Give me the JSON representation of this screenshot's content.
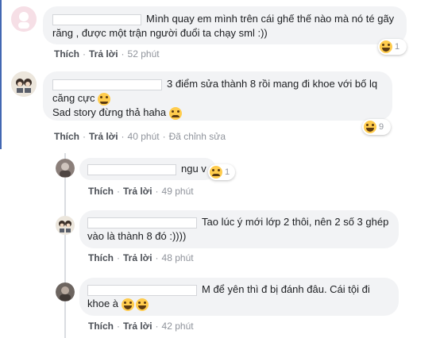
{
  "comments": [
    {
      "text": "Mình quay em mình trên cái ghế thế nào mà nó té gãy răng , được một trận người đuổi ta chạy sml :))",
      "actions": {
        "like": "Thích",
        "reply": "Trả lời",
        "time": "52 phút"
      },
      "reaction_count": "1"
    },
    {
      "text_line1": "3 điểm sửa thành 8 rồi mang đi khoe với bố lq căng cực",
      "text_line2": "Sad story đừng thả haha",
      "actions": {
        "like": "Thích",
        "reply": "Trả lời",
        "time": "40 phút",
        "edited": "Đã chỉnh sửa"
      },
      "reaction_count": "9"
    }
  ],
  "replies": [
    {
      "text": "ngu v",
      "actions": {
        "like": "Thích",
        "reply": "Trả lời",
        "time": "49 phút"
      },
      "reaction_count": "1"
    },
    {
      "text": "Tao lúc ý mới lớp 2 thôi, nên 2 số 3 ghép vào là thành 8 đó :))))",
      "actions": {
        "like": "Thích",
        "reply": "Trả lời",
        "time": "48 phút"
      }
    },
    {
      "text": "M để yên thì đ bị đánh đâu. Cái tội đi khoe à",
      "actions": {
        "like": "Thích",
        "reply": "Trả lời",
        "time": "42 phút"
      }
    }
  ],
  "icons": {
    "reaction": "haha-emoji-icon",
    "smile": "smile-emoji-icon",
    "sad": "frown-emoji-icon",
    "cry": "sad-tear-emoji-icon"
  },
  "colors": {
    "bubble": "#f2f3f5",
    "link": "#4b4f56",
    "meta": "#90949c",
    "accent": "#4267b2",
    "emoji": "#ffcc4d"
  }
}
